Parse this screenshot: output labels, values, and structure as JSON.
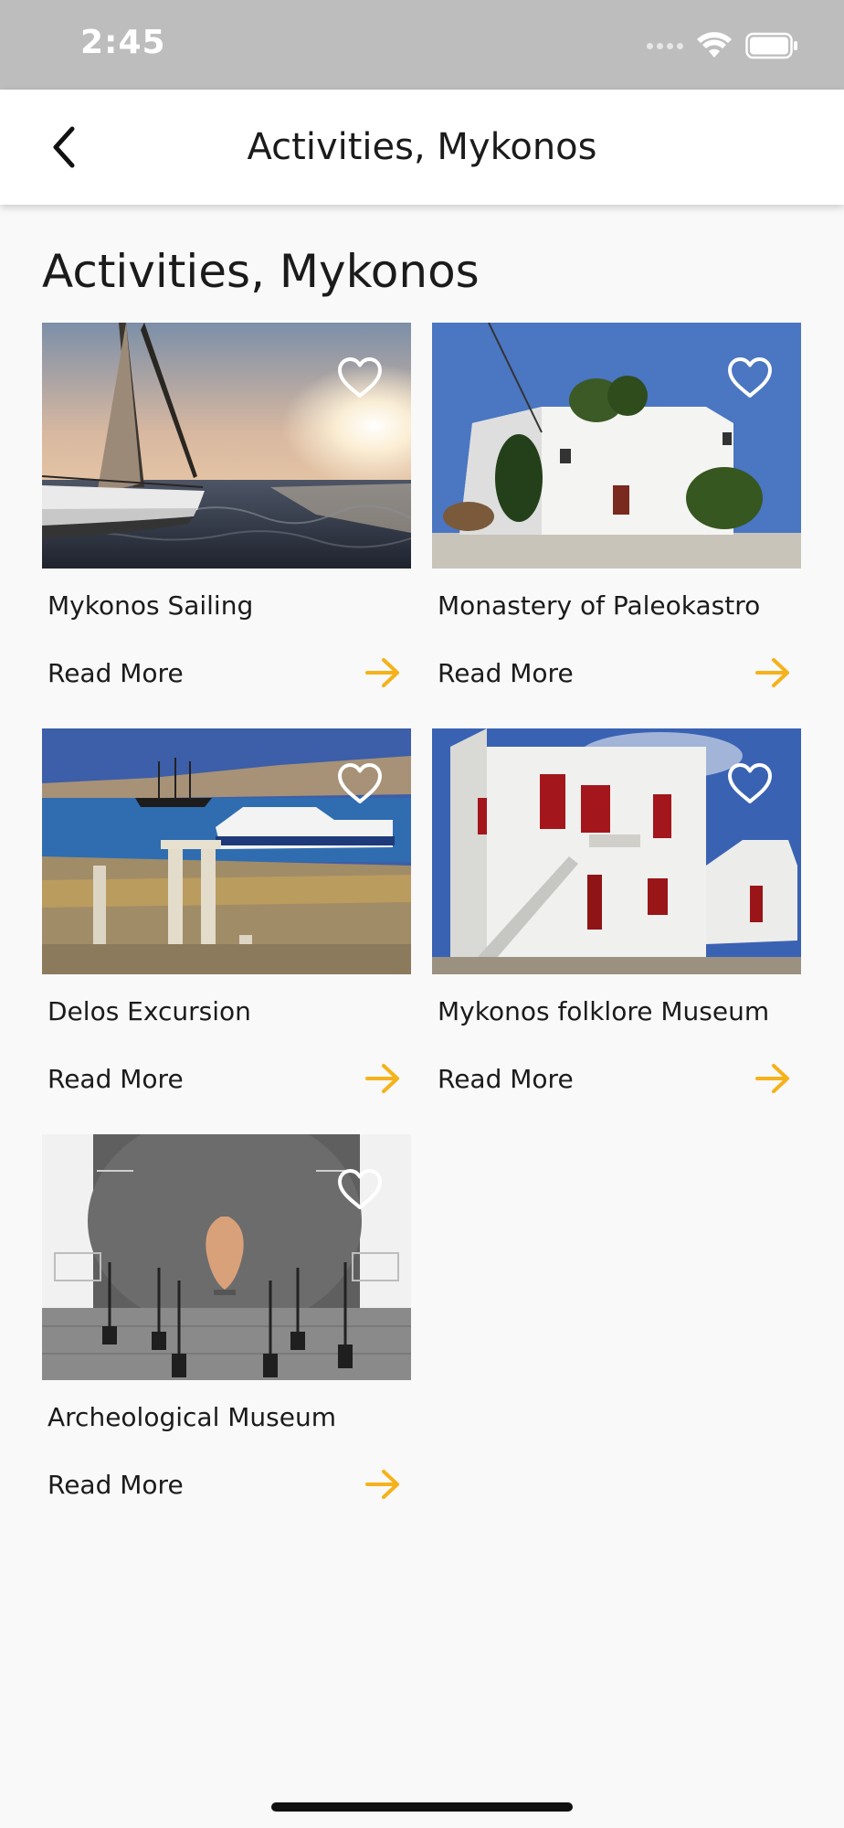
{
  "status_bar": {
    "time": "2:45"
  },
  "header": {
    "title": "Activities, Mykonos",
    "back_icon": "chevron-left-icon"
  },
  "page": {
    "title": "Activities, Mykonos"
  },
  "colors": {
    "accent": "#f5b21b",
    "background": "#f9f9f9",
    "header_bg": "#ffffff",
    "status_bg": "#bdbdbd",
    "text": "#1b1b1b"
  },
  "activities": [
    {
      "title": "Mykonos Sailing",
      "read_more": "Read More",
      "favorite_icon": "heart-outline-icon"
    },
    {
      "title": "Monastery of Paleokastro",
      "read_more": "Read More",
      "favorite_icon": "heart-outline-icon"
    },
    {
      "title": "Delos Excursion",
      "read_more": "Read More",
      "favorite_icon": "heart-outline-icon"
    },
    {
      "title": "Mykonos folklore Museum",
      "read_more": "Read More",
      "favorite_icon": "heart-outline-icon"
    },
    {
      "title": "Archeological Museum",
      "read_more": "Read More",
      "favorite_icon": "heart-outline-icon"
    }
  ]
}
